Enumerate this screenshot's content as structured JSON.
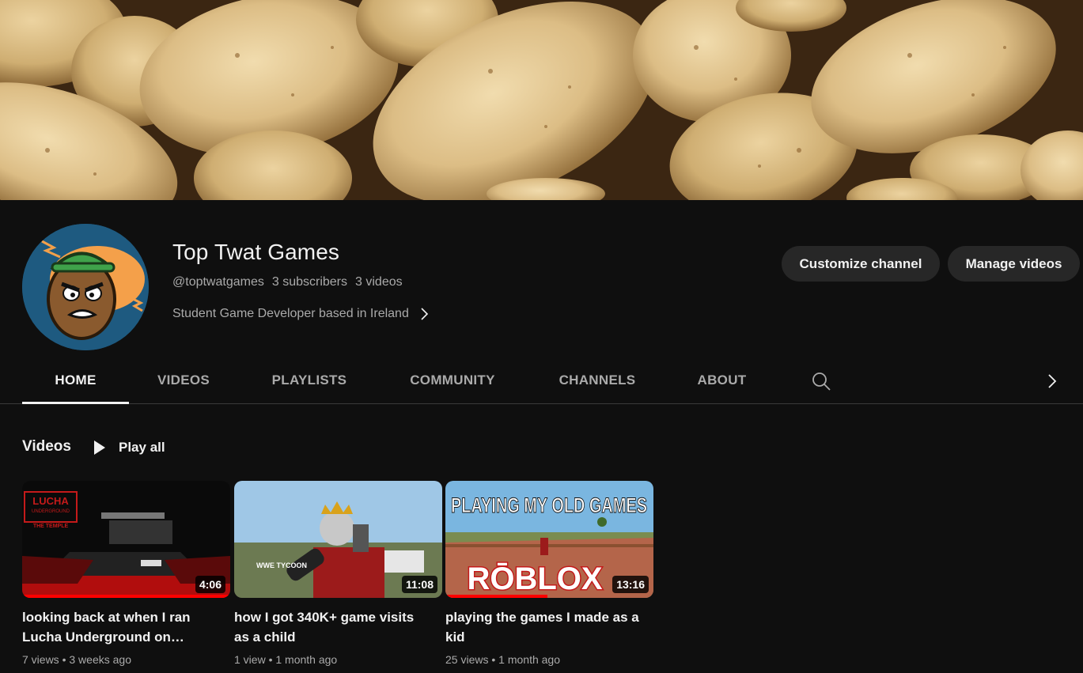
{
  "channel": {
    "title": "Top Twat Games",
    "handle": "@toptwatgames",
    "subscribers": "3 subscribers",
    "video_count": "3 videos",
    "description": "Student Game Developer based in Ireland"
  },
  "buttons": {
    "customize": "Customize channel",
    "manage": "Manage videos"
  },
  "tabs": [
    {
      "label": "HOME",
      "active": true
    },
    {
      "label": "VIDEOS",
      "active": false
    },
    {
      "label": "PLAYLISTS",
      "active": false
    },
    {
      "label": "COMMUNITY",
      "active": false
    },
    {
      "label": "CHANNELS",
      "active": false
    },
    {
      "label": "ABOUT",
      "active": false
    }
  ],
  "icons": {
    "search": "search-icon",
    "next": "chevron-right-icon",
    "play": "play-icon"
  },
  "section": {
    "title": "Videos",
    "play_all": "Play all"
  },
  "videos": [
    {
      "title": "looking back at when I ran Lucha Underground on…",
      "duration": "4:06",
      "views": "7 views",
      "age": "3 weeks ago",
      "watched_fraction": 1.0,
      "thumb_text": [
        "LUCHA",
        "UNDERGROUND",
        "THE TEMPLE"
      ]
    },
    {
      "title": "how I got 340K+ game visits as a child",
      "duration": "11:08",
      "views": "1 view",
      "age": "1 month ago",
      "watched_fraction": 0,
      "thumb_text": [
        "WWE TYCOON"
      ]
    },
    {
      "title": "playing the games I made as a kid",
      "duration": "13:16",
      "views": "25 views",
      "age": "1 month ago",
      "watched_fraction": 0.49,
      "thumb_text": [
        "PLAYING MY OLD GAMES",
        "RŌBLOX"
      ]
    }
  ],
  "colors": {
    "background": "#0f0f0f",
    "button_bg": "#272727",
    "secondary_text": "#aaaaaa",
    "progress": "#ff0000"
  }
}
